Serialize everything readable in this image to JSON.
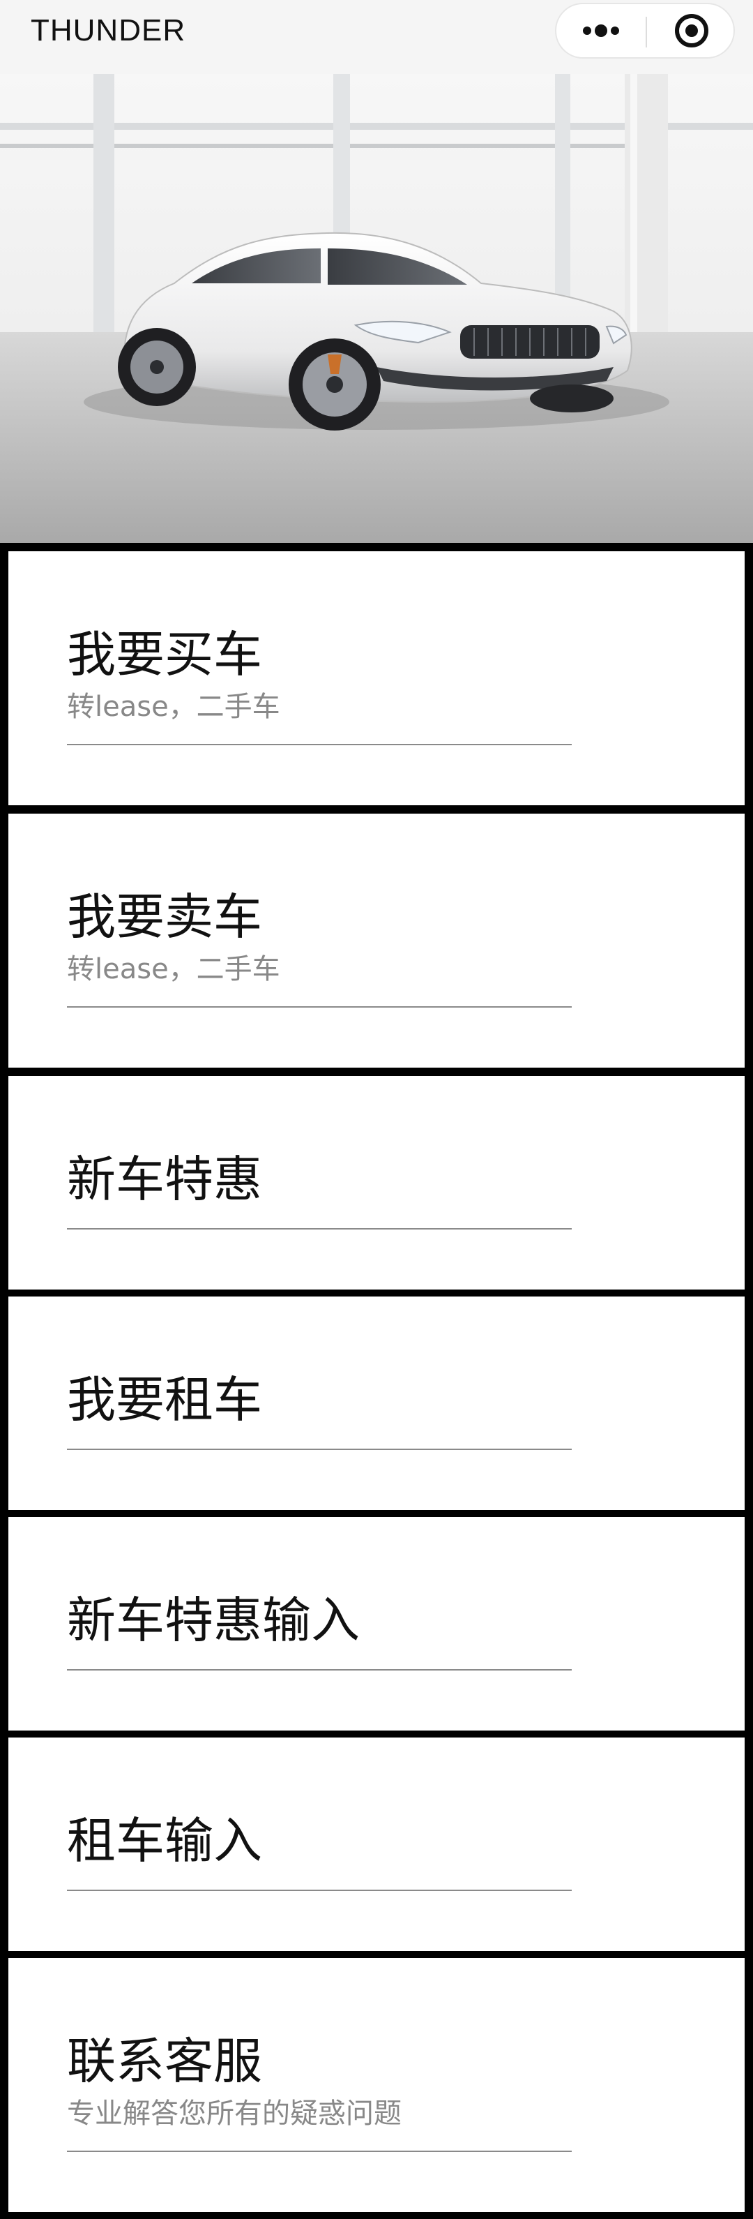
{
  "nav": {
    "title": "THUNDER",
    "more_icon": "more-dots-icon",
    "close_icon": "target-circle-icon"
  },
  "hero": {
    "image": "white-sports-coupe-in-showroom"
  },
  "menu": [
    {
      "title": "我要买车",
      "subtitle": "转lease，二手车"
    },
    {
      "title": "我要卖车",
      "subtitle": "转lease，二手车"
    },
    {
      "title": "新车特惠",
      "subtitle": ""
    },
    {
      "title": "我要租车",
      "subtitle": ""
    },
    {
      "title": "新车特惠输入",
      "subtitle": ""
    },
    {
      "title": "租车输入",
      "subtitle": ""
    },
    {
      "title": "联系客服",
      "subtitle": "专业解答您所有的疑惑问题"
    }
  ],
  "colors": {
    "background": "#000000",
    "card": "#ffffff",
    "title": "#111111",
    "subtitle": "#888888",
    "divider": "#8a8a8a"
  }
}
